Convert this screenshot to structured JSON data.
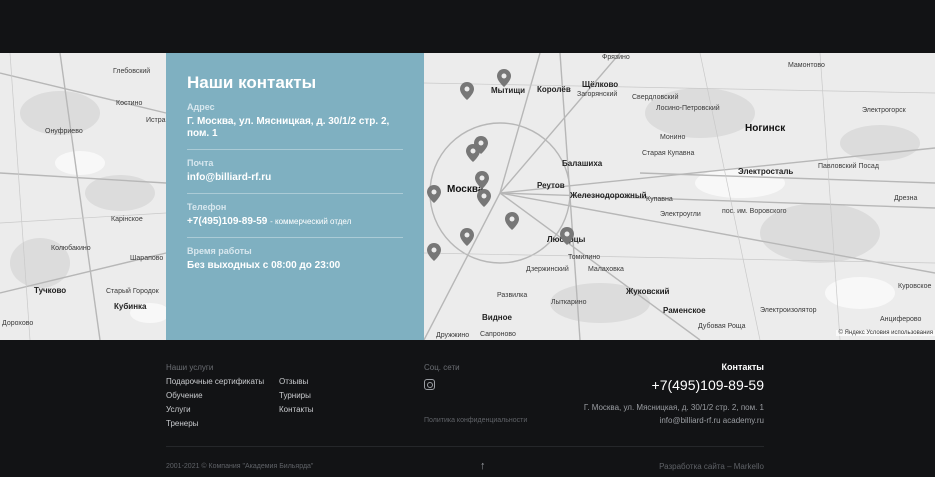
{
  "contacts": {
    "title": "Наши контакты",
    "address_label": "Адрес",
    "address_value": "Г. Москва, ул. Мясницкая, д. 30/1/2 стр. 2, пом. 1",
    "email_label": "Почта",
    "email_value": "info@billiard-rf.ru",
    "phone_label": "Телефон",
    "phone_value": "+7(495)109-89-59",
    "phone_note": "- коммерческий отдел",
    "hours_label": "Время работы",
    "hours_value": "Без выходных с 08:00 до 23:00"
  },
  "map": {
    "labels": [
      "Глебовский",
      "Костино",
      "Истра",
      "Онуфриево",
      "Ермолинo",
      "Карінское",
      "Колюбакино",
      "Шарапово",
      "Тучково",
      "Старый Городок",
      "Кубинка",
      "Дорохово",
      "Фрязино",
      "Щёлково",
      "Мытищи",
      "Королёв",
      "Загорянский",
      "Свердловский",
      "Лосино-Петровский",
      "Монино",
      "Ногинск",
      "Электрогорск",
      "Балашиха",
      "Старая Купавна",
      "Электросталь",
      "Павловский Посад",
      "Москва",
      "Реутов",
      "Железнодорожный",
      "Купавна",
      "Электроугли",
      "Дрезна",
      "пос. им. Воровского",
      "Люберцы",
      "Томилино",
      "Дзержинский",
      "Малаховка",
      "Жуковский",
      "Раменское",
      "Развилка",
      "Лыткарино",
      "Видное",
      "Дружжино",
      "Сапроново",
      "Дубовая Роща",
      "Электроизолятор",
      "Анциферово",
      "Куровское",
      "Мамонтово",
      "Ашукино",
      "Бронницы"
    ],
    "copyright": "© Яндекс Условия использования"
  },
  "footer": {
    "services_title": "Наши услуги",
    "services_col1": [
      "Подарочные сертификаты",
      "Обучение",
      "Услуги",
      "Тренеры"
    ],
    "services_col2": [
      "Отзывы",
      "Турниры",
      "Контакты"
    ],
    "social_title": "Соц. сети",
    "privacy": "Политика конфиденциальности",
    "contacts_title": "Контакты",
    "phone": "+7(495)109-89-59",
    "address": "Г. Москва, ул. Мясницкая, д. 30/1/2 стр. 2, пом. 1",
    "email": "info@billiard-rf.ru academy.ru",
    "copyright": "2001-2021 © Компания \"Академия Бильярда\"",
    "developer": "Разработка сайта – Markello"
  },
  "colors": {
    "card": "#7fb0c1",
    "footer_bg": "#121315",
    "map_bg": "#ececec"
  },
  "icons": [
    "instagram-icon",
    "arrow-up-icon",
    "map-pin-icon"
  ]
}
